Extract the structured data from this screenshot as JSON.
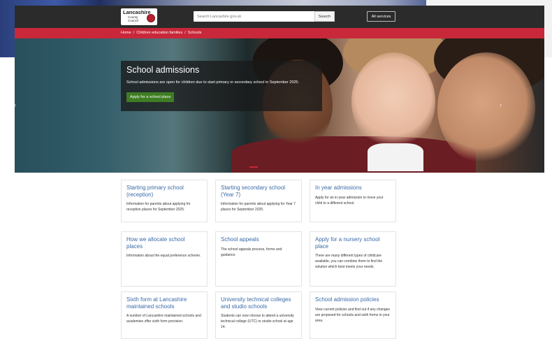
{
  "header": {
    "logo_line1": "Lancashire",
    "logo_line2": "County",
    "logo_line3": "Council",
    "search_placeholder": "Search Lancashire.gov.uk",
    "search_button": "Search",
    "all_services": "All services"
  },
  "breadcrumb": [
    "Home",
    "Children education families",
    "Schools"
  ],
  "hero": {
    "title": "School admissions",
    "text": "School admissions are open for children due to start primary or secondary school in September 2025.",
    "cta": "Apply for a school place",
    "prev": "‹",
    "next": "›"
  },
  "cards": [
    {
      "title": "Starting primary school (reception)",
      "desc": "Information for parents about applying for reception places for September 2025."
    },
    {
      "title": "Starting secondary school (Year 7)",
      "desc": "Information for parents about applying for Year 7 places for September 2025."
    },
    {
      "title": "In year admissions",
      "desc": "Apply for an in-year admission to move your child to a different school."
    },
    {
      "title": "How we allocate school places",
      "desc": "Information about the equal preference scheme."
    },
    {
      "title": "School appeals",
      "desc": "The school appeals process, forms and guidance."
    },
    {
      "title": "Apply for a nursery school place",
      "desc": "There are many different types of childcare available, you can combine them to find the solution which best meets your needs."
    },
    {
      "title": "Sixth form at Lancashire maintained schools",
      "desc": "A number of Lancashire maintained schools and academies offer sixth form provision."
    },
    {
      "title": "University technical colleges and studio schools",
      "desc": "Students can now choose to attend a university technical college (UTC) or studio school at age 14."
    },
    {
      "title": "School admission policies",
      "desc": "View current policies and find out if any changes are proposed for schools and sixth forms in your area."
    }
  ],
  "colors": {
    "header": "#2b2b2b",
    "accent_red": "#c8283a",
    "link_blue": "#3a6aa8",
    "cta_green": "#3e7d23"
  }
}
